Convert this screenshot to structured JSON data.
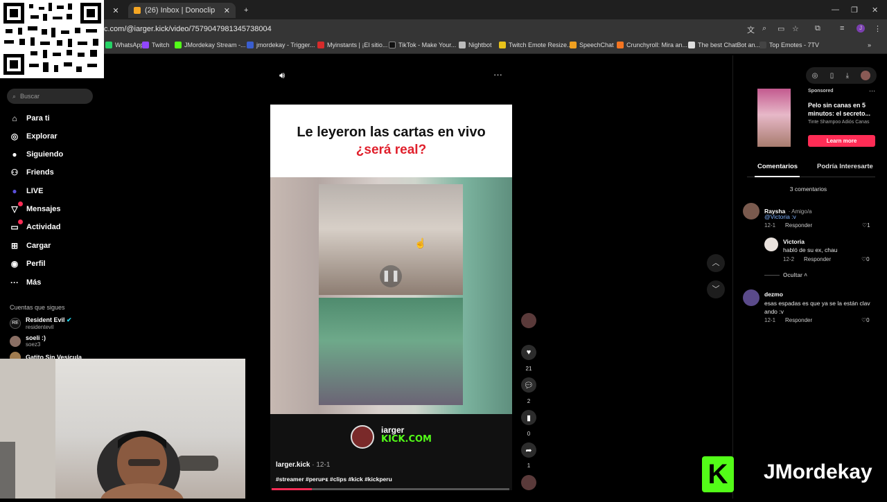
{
  "browser": {
    "tabs": [
      {
        "label": "(26) Inbox | Donoclip"
      }
    ],
    "new_tab": "+",
    "url": "c.com/@iarger.kick/video/7579047981345738004",
    "bookmarks": [
      "WhatsApp",
      "Twitch",
      "JMordekay Stream -...",
      "jmordekay - Trigger...",
      "Myinstants | ¡El sitio...",
      "TikTok - Make Your...",
      "Nightbot",
      "Twitch Emote Resize...",
      "SpeechChat",
      "Crunchyroll: Mira an...",
      "The best ChatBot an...",
      "Top Emotes - 7TV"
    ]
  },
  "sidebar": {
    "search_placeholder": "Buscar",
    "nav": [
      {
        "label": "Para ti",
        "icon": "home-icon"
      },
      {
        "label": "Explorar",
        "icon": "compass-icon"
      },
      {
        "label": "Siguiendo",
        "icon": "following-icon"
      },
      {
        "label": "Friends",
        "icon": "friends-icon"
      },
      {
        "label": "LIVE",
        "icon": "live-icon"
      },
      {
        "label": "Mensajes",
        "icon": "messages-icon"
      },
      {
        "label": "Actividad",
        "icon": "activity-icon"
      },
      {
        "label": "Cargar",
        "icon": "upload-icon"
      },
      {
        "label": "Perfil",
        "icon": "profile-icon"
      },
      {
        "label": "Más",
        "icon": "more-icon"
      }
    ],
    "following_header": "Cuentas que sigues",
    "accounts": [
      {
        "name": "Resident Evil",
        "user": "residentevil"
      },
      {
        "name": "soeli :)",
        "user": "soez3"
      },
      {
        "name": "Gatito Sin Vesícula",
        "user": ""
      }
    ]
  },
  "video": {
    "title_line1": "Le leyeron las cartas en vivo",
    "title_line2": "¿será real?",
    "channel_name": "iarger",
    "channel_site": "KICK.COM",
    "author": "larger.kick",
    "date": "· 12-1",
    "hashtags": "#streamer #peruᴘᴇ #clips #kick #kickperu",
    "progress": 0.17,
    "counts": {
      "likes": "21",
      "comments": "2",
      "saves": "0",
      "shares": "1"
    }
  },
  "ad": {
    "sponsored": "Sponsored",
    "title": "Pelo sin canas en 5 minutos: el secreto...",
    "subtitle": "Tinte Shampoo Adiós Canas",
    "cta": "Learn more"
  },
  "comments_panel": {
    "tabs": [
      "Comentarios",
      "Podría Interesarte"
    ],
    "count_label": "3 comentarios",
    "comments": [
      {
        "name": "Raysha",
        "meta": "· Amigo/a",
        "text": "@Victoria :v",
        "date": "12-1",
        "reply": "Responder",
        "likes": "1"
      },
      {
        "name": "Victoria",
        "meta": "",
        "text": "habló de su ex, chau",
        "date": "12-2",
        "reply": "Responder",
        "likes": "0"
      },
      {
        "name": "dezmo",
        "meta": "",
        "text": "esas espadas es que ya se la están clav ando :v",
        "date": "12-1",
        "reply": "Responder",
        "likes": "0"
      }
    ],
    "hide_label": "Ocultar"
  },
  "overlay": {
    "brand": "JMordekay"
  },
  "colors": {
    "accent": "#fe2c55",
    "kick_green": "#53fc18",
    "red_title": "#e0202c"
  }
}
